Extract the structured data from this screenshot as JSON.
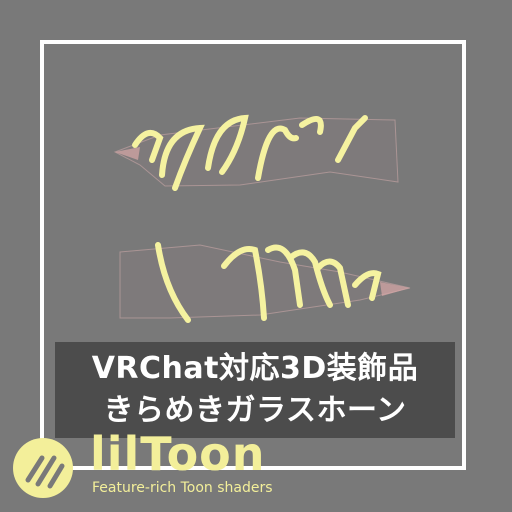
{
  "title": {
    "line1": "VRChat対応3D装飾品",
    "line2": "きらめきガラスホーン"
  },
  "logo": {
    "wordmark": "lilToon",
    "tagline": "Feature-rich Toon shaders",
    "icon": "liltoon-logo-icon"
  },
  "colors": {
    "background": "#797979",
    "frame": "#ffffff",
    "accent": "#f3ef9a",
    "title_bg": "#464646"
  }
}
